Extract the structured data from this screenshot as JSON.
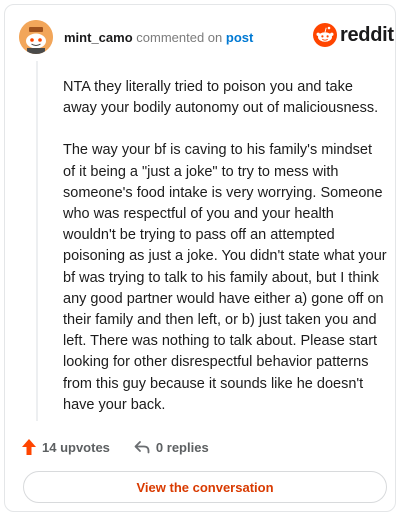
{
  "header": {
    "username": "mint_camo",
    "action_text": "commented on",
    "post_link": "post",
    "logo_text": "reddit"
  },
  "comment": {
    "paragraphs": [
      "NTA they literally tried to poison you and take away your bodily autonomy out of maliciousness.",
      "The way your bf is caving to his family's mindset of it being a \"just a joke\" to try to mess with someone's food intake is very worrying. Someone who was respectful of you and your health wouldn't be trying to pass off an attempted poisoning as just a joke. You didn't state what your bf was trying to talk to his family about, but I think any good partner would have either a) gone off on their family and then left, or b) just taken you and left. There was nothing to talk about. Please start looking for other disrespectful behavior patterns from this guy because it sounds like he doesn't have your back."
    ]
  },
  "actions": {
    "upvotes": "14 upvotes",
    "replies": "0 replies"
  },
  "footer": {
    "view_button": "View the conversation"
  },
  "icons": {
    "avatar": "snoo-avatar-icon",
    "logo": "reddit-logo-icon",
    "upvote": "upvote-arrow-icon",
    "reply": "reply-arrow-icon"
  },
  "colors": {
    "brand": "#ff4500",
    "link": "#0079d3",
    "button_text": "#d93a00",
    "upvote": "#ff4500"
  }
}
